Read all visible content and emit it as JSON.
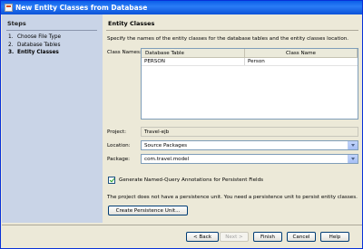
{
  "window": {
    "title": "New Entity Classes from Database"
  },
  "steps": {
    "header": "Steps",
    "items": [
      {
        "num": "1.",
        "label": "Choose File Type"
      },
      {
        "num": "2.",
        "label": "Database Tables"
      },
      {
        "num": "3.",
        "label": "Entity Classes"
      }
    ]
  },
  "panel": {
    "header": "Entity Classes",
    "description": "Specify the names of the entity classes for the database tables and the entity classes location.",
    "class_names_label": "Class Names:",
    "table": {
      "columns": [
        "Database Table",
        "Class Name"
      ],
      "rows": [
        {
          "db_table": "PERSON",
          "class_name": "Person"
        }
      ]
    },
    "project_label": "Project:",
    "project_value": "Travel-ejb",
    "location_label": "Location:",
    "location_value": "Source Packages",
    "package_label": "Package:",
    "package_value": "com.travel.model",
    "checkbox_label": "Generate Named-Query Annotations for Persistent Fields",
    "checkbox_checked": true,
    "persistence_note": "The project does not have a persistence unit. You need a persistence unit to persist entity classes.",
    "create_pu_button": "Create Persistence Unit..."
  },
  "buttons": {
    "back": "< Back",
    "next": "Next >",
    "finish": "Finish",
    "cancel": "Cancel",
    "help": "Help"
  }
}
